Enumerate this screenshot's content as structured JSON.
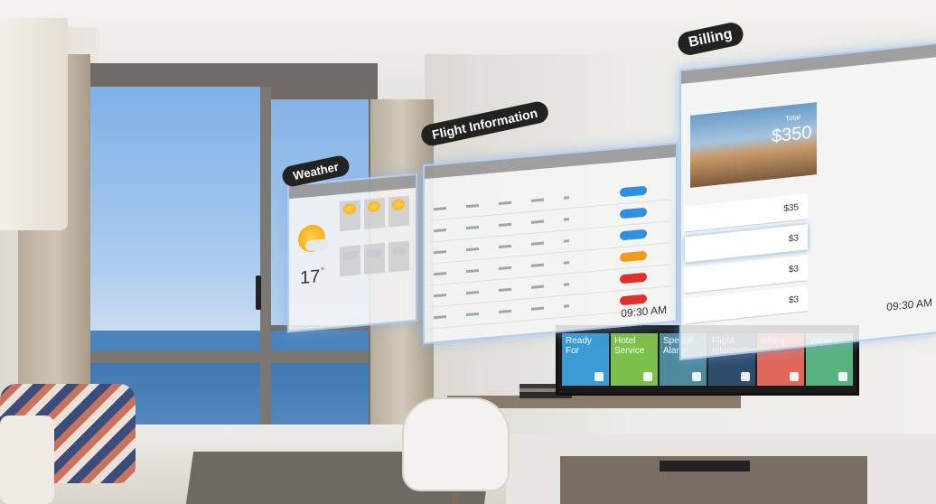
{
  "weather_tag": "Weather",
  "flight_tag": "Flight Information",
  "billing_tag": "Billing",
  "weather_panel": {
    "temp": "17",
    "unit": "°"
  },
  "flight_panel": {
    "time": "09:30 AM"
  },
  "billing_panel": {
    "total_label": "Total",
    "total_value": "$350",
    "time": "09:30 AM",
    "amounts": [
      "$35",
      "$3",
      "$3",
      "$3"
    ]
  },
  "tv_menu": {
    "tiles": [
      {
        "label": "Ready\nFor",
        "color": "#3a9ad3"
      },
      {
        "label": "Hotel\nService",
        "color": "#7cbf4a"
      },
      {
        "label": "Special\nAlarm",
        "color": "#4e8a9c"
      },
      {
        "label": "Flight\nInformation",
        "color": "#2e4b6a"
      },
      {
        "label": "Billing",
        "color": "#e0685a"
      },
      {
        "label": "Weather",
        "color": "#58b27d"
      }
    ]
  },
  "colors": {
    "status_blue": "#2f8fe0",
    "status_orange": "#f29b1a",
    "status_red": "#e0302c"
  }
}
